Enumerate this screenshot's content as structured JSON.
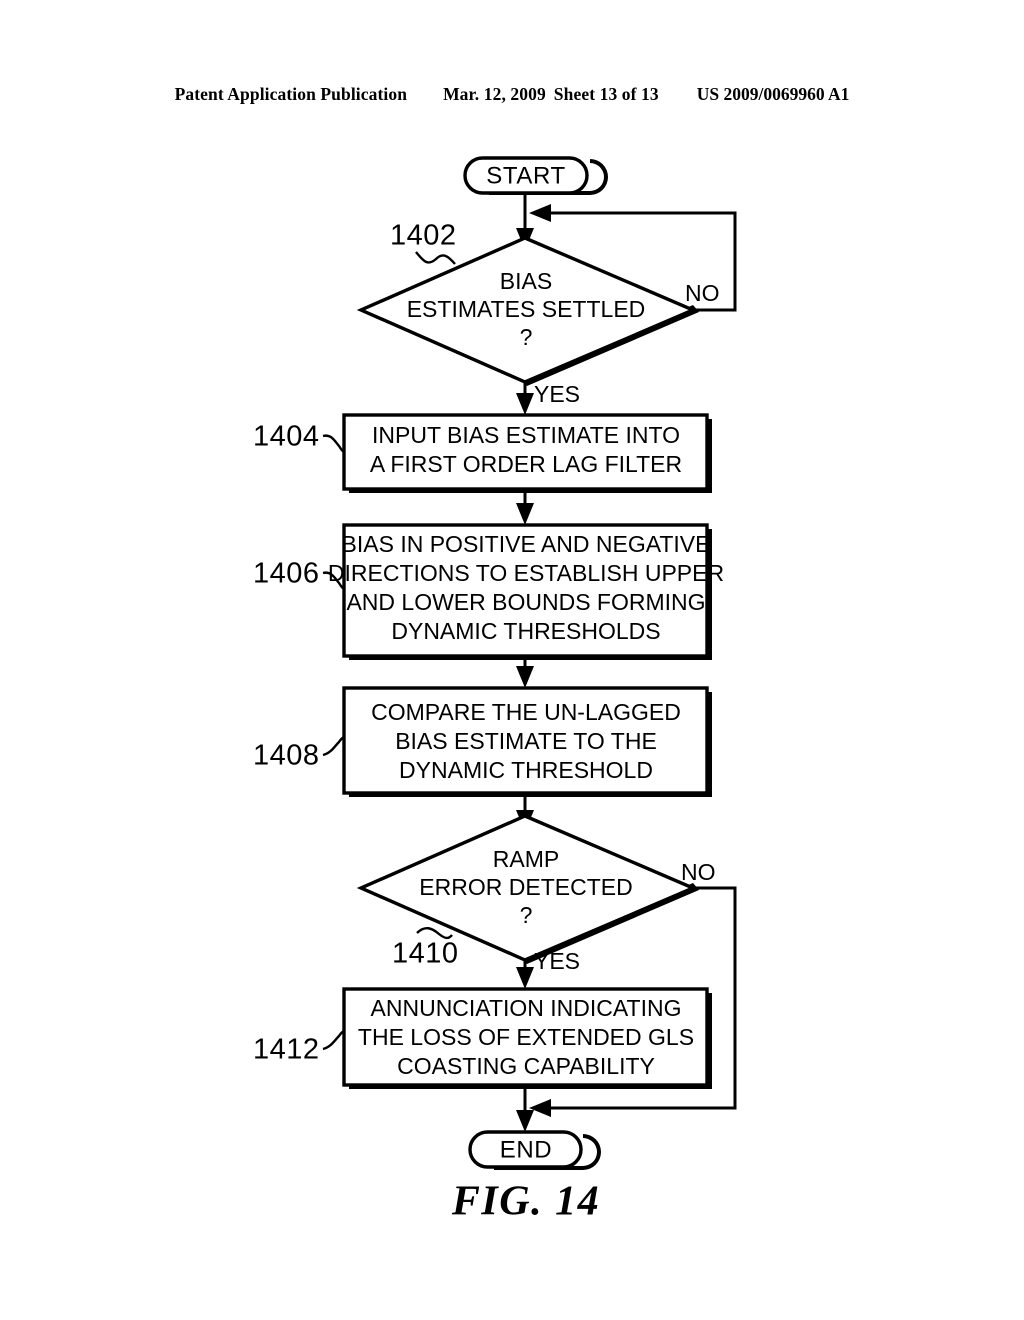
{
  "header": {
    "publication": "Patent Application Publication",
    "date": "Mar. 12, 2009",
    "sheet": "Sheet 13 of 13",
    "patent_number": "US 2009/0069960 A1"
  },
  "figure": {
    "caption": "FIG. 14",
    "start_label": "START",
    "end_label": "END"
  },
  "nodes": {
    "decision_1402": {
      "ref": "1402",
      "line1": "BIAS",
      "line2": "ESTIMATES SETTLED",
      "line3": "?",
      "branch_no": "NO",
      "branch_yes": "YES"
    },
    "process_1404": {
      "ref": "1404",
      "line1": "INPUT BIAS ESTIMATE INTO",
      "line2": "A FIRST ORDER LAG FILTER"
    },
    "process_1406": {
      "ref": "1406",
      "line1": "BIAS IN POSITIVE AND NEGATIVE",
      "line2": "DIRECTIONS TO ESTABLISH UPPER",
      "line3": "AND LOWER BOUNDS FORMING",
      "line4": "DYNAMIC THRESHOLDS"
    },
    "process_1408": {
      "ref": "1408",
      "line1": "COMPARE THE UN-LAGGED",
      "line2": "BIAS ESTIMATE TO THE",
      "line3": "DYNAMIC THRESHOLD"
    },
    "decision_1410": {
      "ref": "1410",
      "line1": "RAMP",
      "line2": "ERROR DETECTED",
      "line3": "?",
      "branch_no": "NO",
      "branch_yes": "YES"
    },
    "process_1412": {
      "ref": "1412",
      "line1": "ANNUNCIATION INDICATING",
      "line2": "THE LOSS OF EXTENDED GLS",
      "line3": "COASTING CAPABILITY"
    }
  },
  "colors": {
    "ink": "#000000",
    "paper": "#ffffff"
  }
}
